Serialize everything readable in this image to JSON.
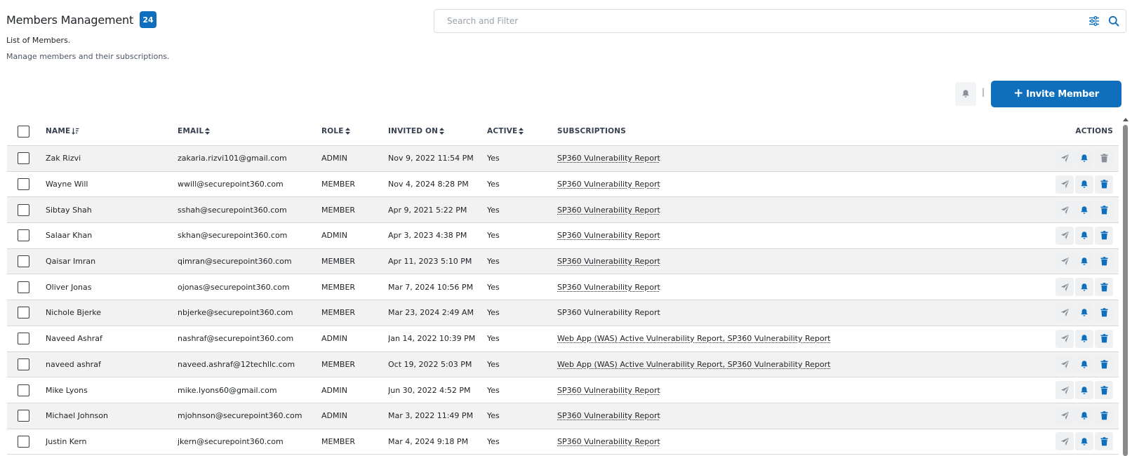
{
  "header": {
    "title": "Members Management",
    "count": "24",
    "subtitle": "List of Members.",
    "description": "Manage members and their subscriptions."
  },
  "search": {
    "placeholder": "Search and Filter",
    "filter_icon": "sliders-icon",
    "search_icon": "search-icon"
  },
  "toolbar": {
    "bell_icon": "bell-icon",
    "separator": "|",
    "invite_label": "Invite Member"
  },
  "colors": {
    "accent": "#0f6fbd",
    "row_stripe": "#f2f2f2",
    "icon_gray": "#8a9099"
  },
  "table": {
    "columns": {
      "name": "NAME",
      "email": "EMAIL",
      "role": "ROLE",
      "invited": "INVITED ON",
      "active": "ACTIVE",
      "subscriptions": "SUBSCRIPTIONS",
      "actions": "ACTIONS"
    },
    "rows": [
      {
        "name": "Zak Rizvi",
        "email": "zakaria.rizvi101@gmail.com",
        "role": "ADMIN",
        "invited": "Nov 9, 2022 11:54 PM",
        "active": "Yes",
        "subscriptions": "SP360 Vulnerability Report",
        "delete_enabled": false
      },
      {
        "name": "Wayne Will",
        "email": "wwill@securepoint360.com",
        "role": "MEMBER",
        "invited": "Nov 4, 2024 8:28 PM",
        "active": "Yes",
        "subscriptions": "SP360 Vulnerability Report",
        "delete_enabled": true
      },
      {
        "name": "Sibtay Shah",
        "email": "sshah@securepoint360.com",
        "role": "MEMBER",
        "invited": "Apr 9, 2021 5:22 PM",
        "active": "Yes",
        "subscriptions": "SP360 Vulnerability Report",
        "delete_enabled": true
      },
      {
        "name": "Salaar Khan",
        "email": "skhan@securepoint360.com",
        "role": "ADMIN",
        "invited": "Apr 3, 2023 4:38 PM",
        "active": "Yes",
        "subscriptions": "SP360 Vulnerability Report",
        "delete_enabled": true
      },
      {
        "name": "Qaisar Imran",
        "email": "qimran@securepoint360.com",
        "role": "MEMBER",
        "invited": "Apr 11, 2023 5:10 PM",
        "active": "Yes",
        "subscriptions": "SP360 Vulnerability Report",
        "delete_enabled": true
      },
      {
        "name": "Oliver Jonas",
        "email": "ojonas@securepoint360.com",
        "role": "MEMBER",
        "invited": "Mar 7, 2024 10:56 PM",
        "active": "Yes",
        "subscriptions": "SP360 Vulnerability Report",
        "delete_enabled": true
      },
      {
        "name": "Nichole Bjerke",
        "email": "nbjerke@securepoint360.com",
        "role": "MEMBER",
        "invited": "Mar 23, 2024 2:49 AM",
        "active": "Yes",
        "subscriptions": "SP360 Vulnerability Report",
        "delete_enabled": true
      },
      {
        "name": "Naveed Ashraf",
        "email": "nashraf@securepoint360.com",
        "role": "ADMIN",
        "invited": "Jan 14, 2022 10:39 PM",
        "active": "Yes",
        "subscriptions": "Web App (WAS) Active Vulnerability Report, SP360 Vulnerability Report",
        "delete_enabled": true
      },
      {
        "name": "naveed ashraf",
        "email": "naveed.ashraf@12techllc.com",
        "role": "MEMBER",
        "invited": "Oct 19, 2022 5:03 PM",
        "active": "Yes",
        "subscriptions": "Web App (WAS) Active Vulnerability Report, SP360 Vulnerability Report",
        "delete_enabled": true
      },
      {
        "name": "Mike Lyons",
        "email": "mike.lyons60@gmail.com",
        "role": "ADMIN",
        "invited": "Jun 30, 2022 4:52 PM",
        "active": "Yes",
        "subscriptions": "SP360 Vulnerability Report",
        "delete_enabled": true
      },
      {
        "name": "Michael Johnson",
        "email": "mjohnson@securepoint360.com",
        "role": "ADMIN",
        "invited": "Mar 3, 2022 11:49 PM",
        "active": "Yes",
        "subscriptions": "SP360 Vulnerability Report",
        "delete_enabled": true
      },
      {
        "name": "Justin Kern",
        "email": "jkern@securepoint360.com",
        "role": "MEMBER",
        "invited": "Mar 4, 2024 9:18 PM",
        "active": "Yes",
        "subscriptions": "SP360 Vulnerability Report",
        "delete_enabled": true
      }
    ],
    "row_action_icons": [
      "send-icon",
      "bell-icon",
      "trash-icon"
    ]
  }
}
